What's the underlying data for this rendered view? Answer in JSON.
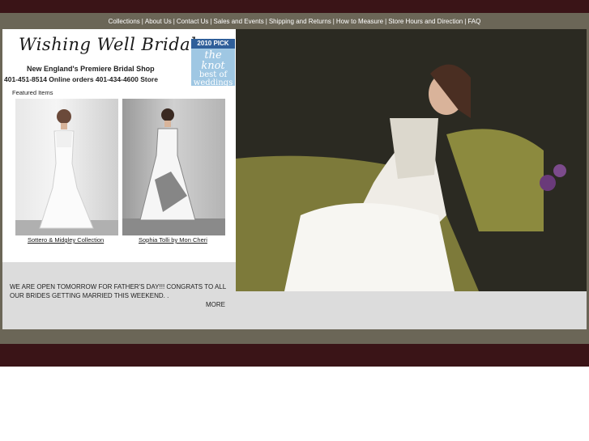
{
  "nav": {
    "items": [
      {
        "label": "Collections"
      },
      {
        "label": "About Us"
      },
      {
        "label": "Contact Us"
      },
      {
        "label": "Sales and Events"
      },
      {
        "label": "Shipping and Returns"
      },
      {
        "label": "How to Measure"
      },
      {
        "label": "Store Hours and Direction"
      },
      {
        "label": "FAQ"
      }
    ],
    "separator": "|"
  },
  "brand": {
    "logo_text": "Wishing Well Bridal",
    "tagline": "New England's Premiere Bridal Shop",
    "phones": "401-451-8514  Online orders  401-434-4600  Store"
  },
  "badge": {
    "year": "2010 PICK",
    "name": "the knot",
    "line1": "best of",
    "line2": "weddings"
  },
  "featured": {
    "label": "Featured Items",
    "items": [
      {
        "caption": "Sottero & Midgley Collection"
      },
      {
        "caption": "Sophia Tolli by Mon Cheri"
      }
    ]
  },
  "news": {
    "text": "WE ARE OPEN TOMORROW FOR FATHER'S DAY!!! CONGRATS TO ALL OUR BRIDES GETTING MARRIED THIS WEEKEND. .",
    "more": "MORE"
  },
  "colors": {
    "band": "#3a1417",
    "bar": "#6b6657",
    "panel": "#dcdcdc"
  }
}
